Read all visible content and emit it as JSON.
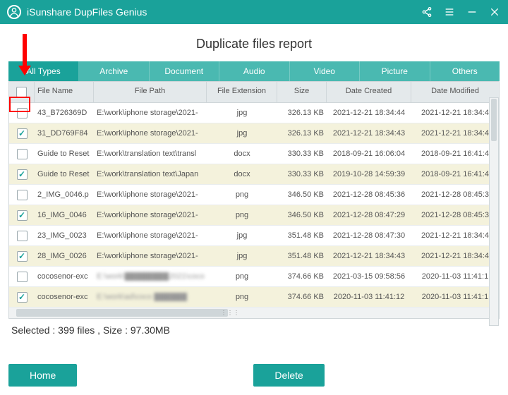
{
  "titlebar": {
    "app_name": "iSunshare DupFiles Genius"
  },
  "page_title": "Duplicate files report",
  "tabs": [
    "All Types",
    "Archive",
    "Document",
    "Audio",
    "Video",
    "Picture",
    "Others"
  ],
  "columns": {
    "name": "File Name",
    "path": "File Path",
    "ext": "File Extension",
    "size": "Size",
    "created": "Date Created",
    "modified": "Date Modified"
  },
  "rows": [
    {
      "checked": false,
      "name": "43_B726369D",
      "path": "E:\\work\\iphone storage\\2021-",
      "ext": "jpg",
      "size": "326.13 KB",
      "created": "2021-12-21 18:34:44",
      "modified": "2021-12-21 18:34:4"
    },
    {
      "checked": true,
      "name": "31_DD769F84",
      "path": "E:\\work\\iphone storage\\2021-",
      "ext": "jpg",
      "size": "326.13 KB",
      "created": "2021-12-21 18:34:43",
      "modified": "2021-12-21 18:34:4"
    },
    {
      "checked": false,
      "name": "Guide to Reset",
      "path": "E:\\work\\translation text\\transl",
      "ext": "docx",
      "size": "330.33 KB",
      "created": "2018-09-21 16:06:04",
      "modified": "2018-09-21 16:41:4"
    },
    {
      "checked": true,
      "name": "Guide to Reset",
      "path": "E:\\work\\translation text\\Japan",
      "ext": "docx",
      "size": "330.33 KB",
      "created": "2019-10-28 14:59:39",
      "modified": "2018-09-21 16:41:4"
    },
    {
      "checked": false,
      "name": "2_IMG_0046.p",
      "path": "E:\\work\\iphone storage\\2021-",
      "ext": "png",
      "size": "346.50 KB",
      "created": "2021-12-28 08:45:36",
      "modified": "2021-12-28 08:45:3"
    },
    {
      "checked": true,
      "name": "16_IMG_0046",
      "path": "E:\\work\\iphone storage\\2021-",
      "ext": "png",
      "size": "346.50 KB",
      "created": "2021-12-28 08:47:29",
      "modified": "2021-12-28 08:45:3"
    },
    {
      "checked": false,
      "name": "23_IMG_0023",
      "path": "E:\\work\\iphone storage\\2021-",
      "ext": "jpg",
      "size": "351.48 KB",
      "created": "2021-12-28 08:47:30",
      "modified": "2021-12-21 18:34:4"
    },
    {
      "checked": true,
      "name": "28_IMG_0026",
      "path": "E:\\work\\iphone storage\\2021-",
      "ext": "jpg",
      "size": "351.48 KB",
      "created": "2021-12-21 18:34:43",
      "modified": "2021-12-21 18:34:4"
    },
    {
      "checked": false,
      "name": "cocosenor-exc",
      "path": "E:\\work\\████████2021\\coco",
      "ext": "png",
      "size": "374.66 KB",
      "created": "2021-03-15 09:58:56",
      "modified": "2020-11-03 11:41:1",
      "blurpath": true
    },
    {
      "checked": true,
      "name": "cocosenor-exc",
      "path": "E:\\work\\ad\\coco ██████",
      "ext": "png",
      "size": "374.66 KB",
      "created": "2020-11-03 11:41:12",
      "modified": "2020-11-03 11:41:1",
      "blurpath": true
    }
  ],
  "status": "Selected : 399  files ,   Size : 97.30MB",
  "buttons": {
    "home": "Home",
    "delete": "Delete"
  }
}
